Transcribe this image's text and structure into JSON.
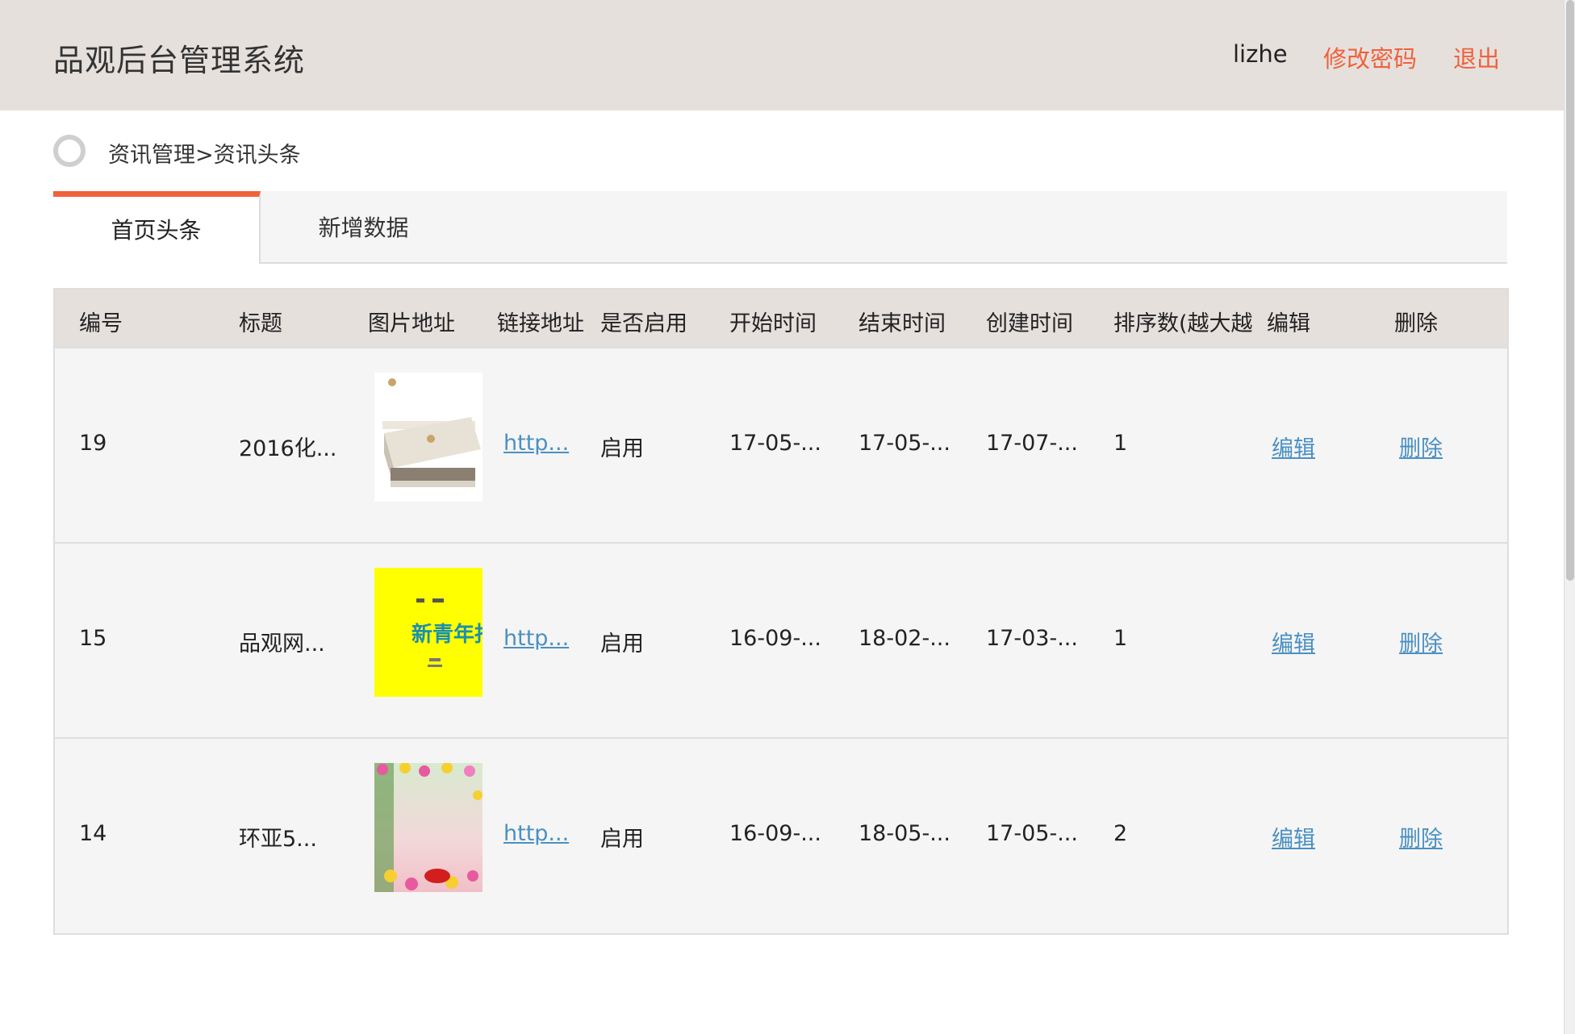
{
  "header": {
    "title": "品观后台管理系统",
    "user": "lizhe",
    "change_password": "修改密码",
    "logout": "退出"
  },
  "breadcrumb": "资讯管理>资讯头条",
  "tabs": [
    {
      "label": "首页头条"
    },
    {
      "label": "新增数据"
    }
  ],
  "table": {
    "columns": [
      "编号",
      "标题",
      "图片地址",
      "链接地址",
      "是否启用",
      "开始时间",
      "结束时间",
      "创建时间",
      "排序数(越大越",
      "编辑",
      "删除"
    ],
    "rows": [
      {
        "id": "19",
        "title": "2016化...",
        "link": "http...",
        "enabled": "启用",
        "start": "17-05-...",
        "end": "17-05-...",
        "created": "17-07-...",
        "sort": "1",
        "edit": "编辑",
        "delete": "删除",
        "thumb_icon": "product-box-image"
      },
      {
        "id": "15",
        "title": "品观网...",
        "link": "http...",
        "enabled": "启用",
        "start": "16-09-...",
        "end": "18-02-...",
        "created": "17-03-...",
        "sort": "1",
        "edit": "编辑",
        "delete": "删除",
        "thumb_icon": "yellow-poster-image",
        "thumb_text": "新青年报"
      },
      {
        "id": "14",
        "title": "环亚5...",
        "link": "http...",
        "enabled": "启用",
        "start": "16-09-...",
        "end": "18-05-...",
        "created": "17-05-...",
        "sort": "2",
        "edit": "编辑",
        "delete": "删除",
        "thumb_icon": "flower-frame-image"
      }
    ]
  },
  "colors": {
    "accent": "#f0613b",
    "header_bg": "#e6e0dd",
    "link": "#4a90c2",
    "table_bg": "#f5f5f5"
  }
}
